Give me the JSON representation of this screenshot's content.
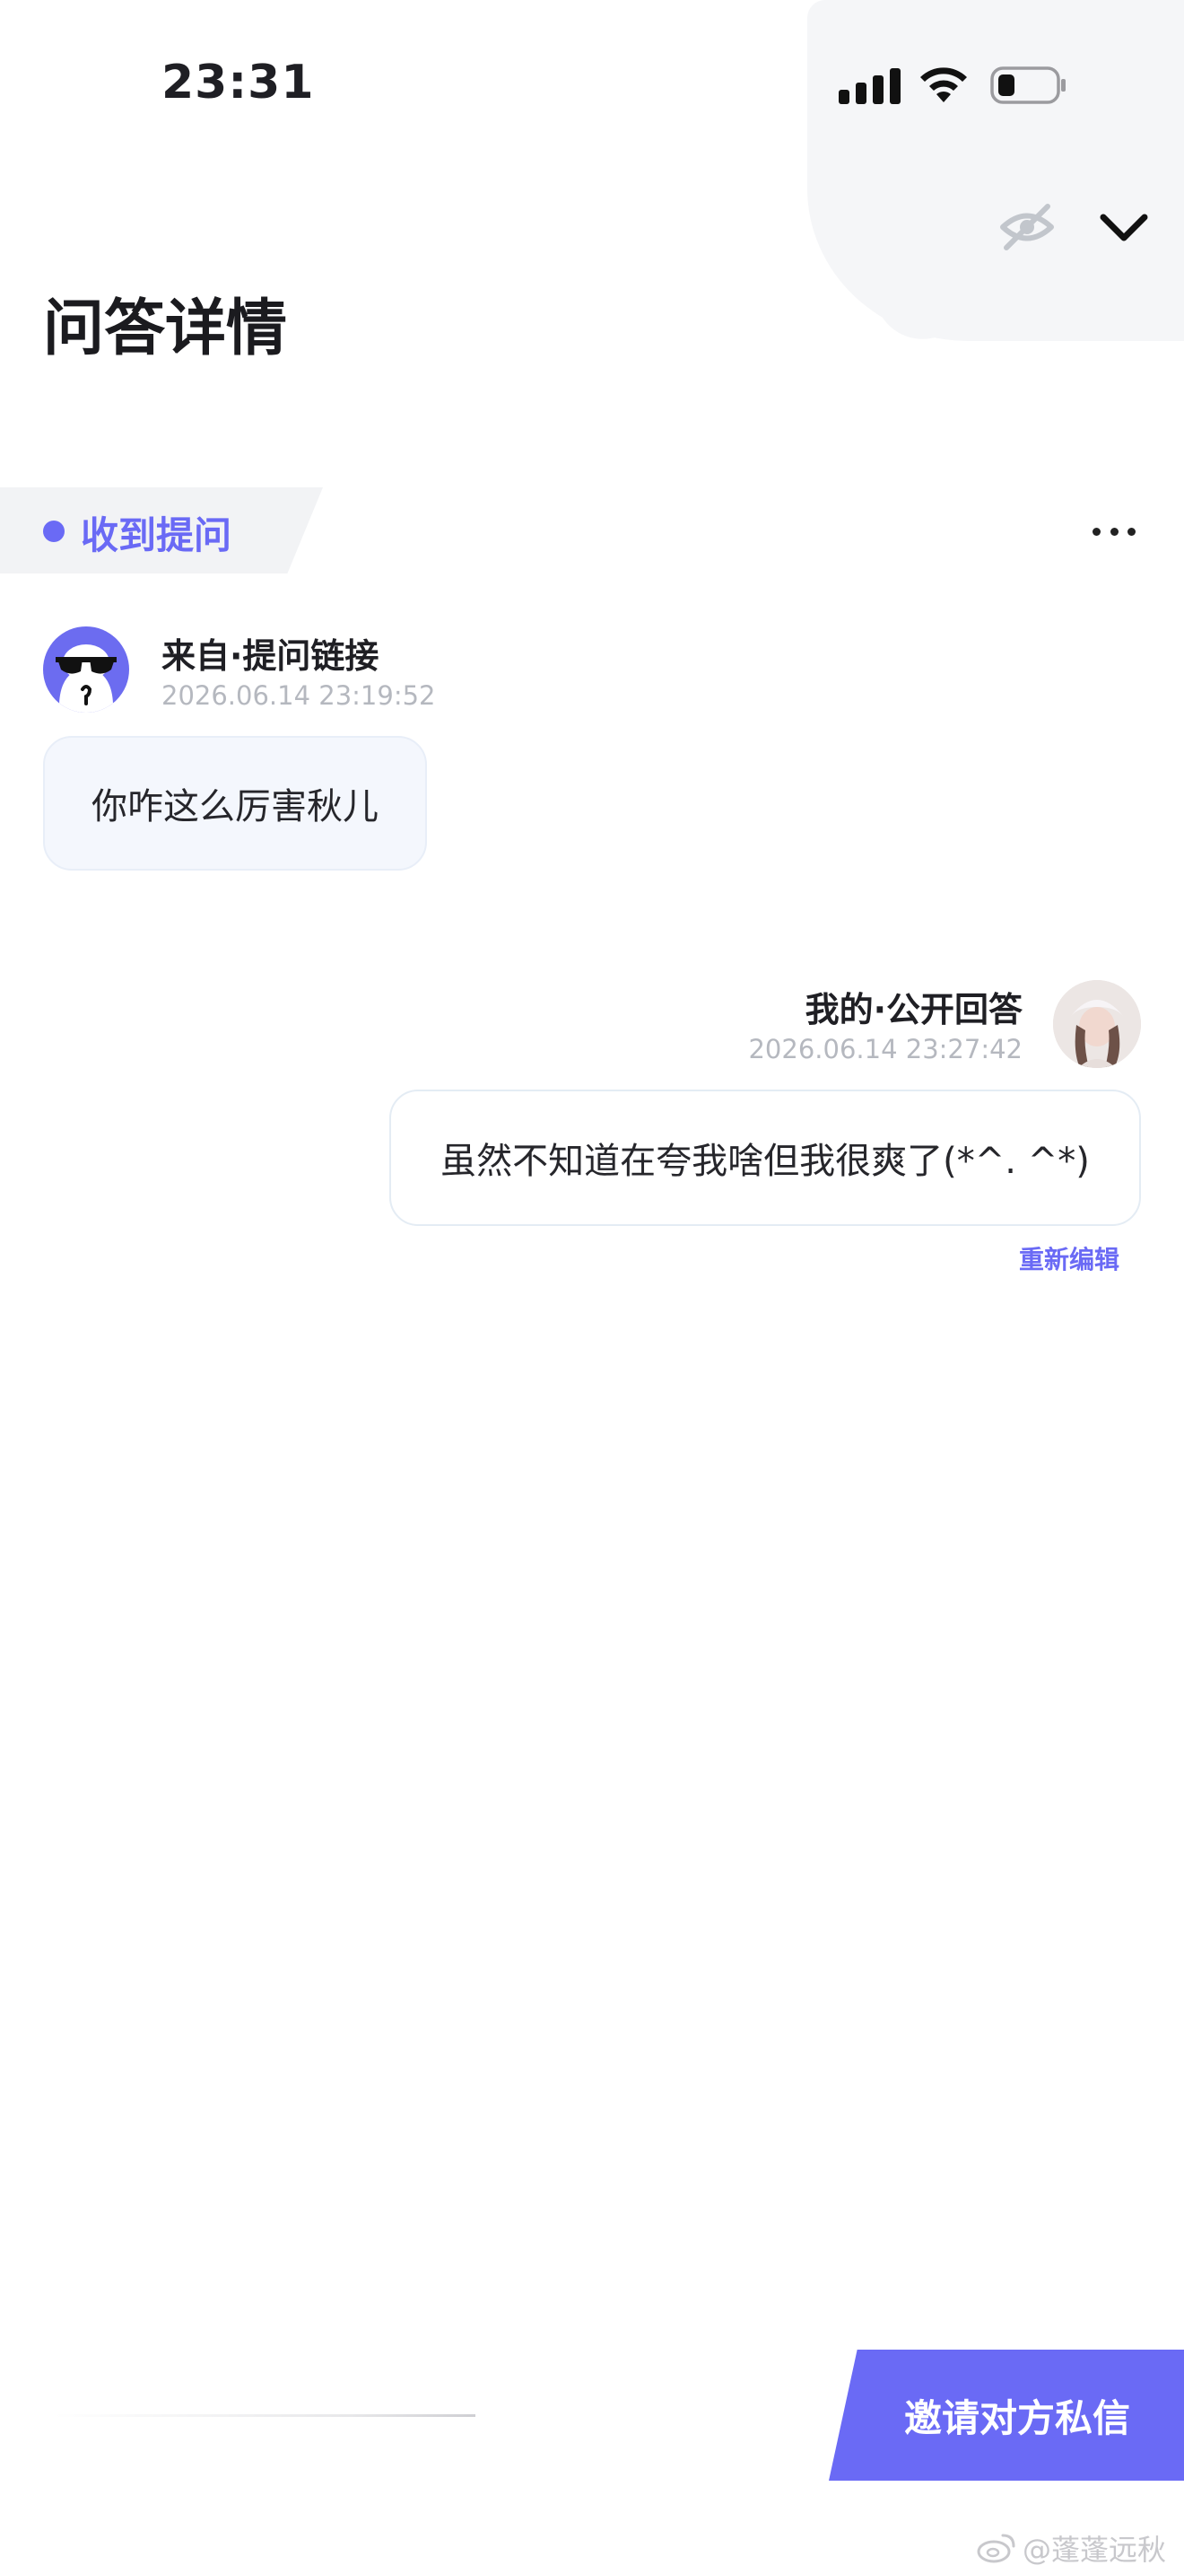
{
  "status_bar": {
    "time": "23:31"
  },
  "header": {
    "title": "问答详情"
  },
  "received_tag": {
    "label": "收到提问"
  },
  "question": {
    "source": "来自·提问链接",
    "timestamp": "2026.06.14 23:19:52",
    "text": "你咋这么厉害秋儿"
  },
  "answer": {
    "source": "我的·公开回答",
    "timestamp": "2026.06.14 23:27:42",
    "text": "虽然不知道在夸我啥但我很爽了(*^.  ^*)",
    "edit_label": "重新编辑"
  },
  "bottom": {
    "invite_label": "邀请对方私信"
  },
  "watermark": {
    "text": "@蓬蓬远秋"
  },
  "colors": {
    "accent": "#6a6af5",
    "muted": "#b5b8bf",
    "bubble_bg": "#f4f7fd"
  },
  "icons": [
    "wifi-icon",
    "battery-icon",
    "signal-icon",
    "hide-icon",
    "chevron-down-icon",
    "more-icon"
  ]
}
